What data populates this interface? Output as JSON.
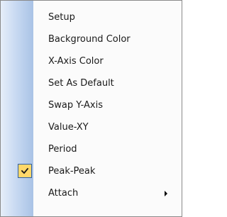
{
  "menu": {
    "items": [
      {
        "label": "Setup"
      },
      {
        "label": "Background Color"
      },
      {
        "label": "X-Axis Color"
      },
      {
        "label": "Set As Default"
      },
      {
        "label": "Swap Y-Axis"
      },
      {
        "label": "Value-XY"
      },
      {
        "label": "Period"
      },
      {
        "label": "Peak-Peak",
        "checked": true,
        "check_icon": "checkmark-icon"
      },
      {
        "label": "Attach",
        "submenu_icon": "chevron-right-icon"
      }
    ]
  },
  "colors": {
    "gutter_start": "#e6eef9",
    "gutter_end": "#a9c3e6",
    "check_highlight": "#ffd86a",
    "check_border": "#2f5fa3",
    "menu_background": "#fbfbfb",
    "menu_border": "#8a8a8a"
  }
}
